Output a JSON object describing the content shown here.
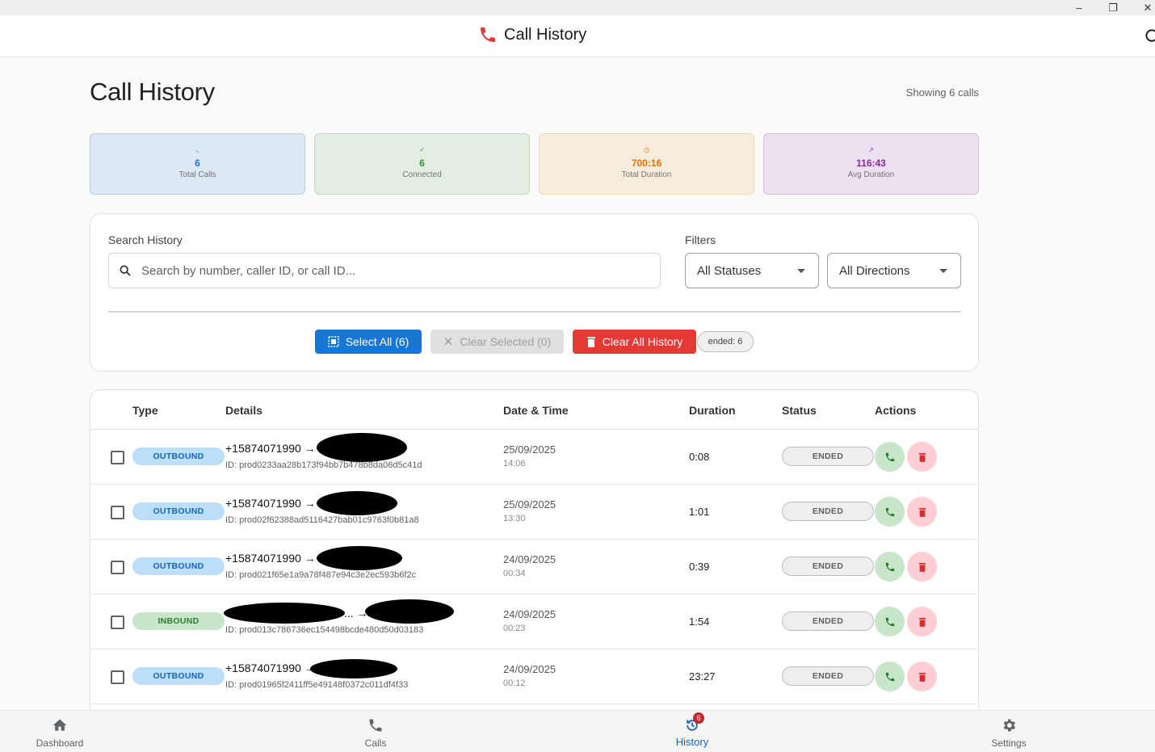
{
  "window": {
    "min": "–",
    "max": "❐",
    "close": "✕"
  },
  "header": {
    "title": "Call History"
  },
  "page": {
    "title": "Call History",
    "showing": "Showing 6 calls"
  },
  "stats": [
    {
      "value": "6",
      "label": "Total Calls",
      "color": "#1976d2",
      "icon": "phone-icon"
    },
    {
      "value": "6",
      "label": "Connected",
      "color": "#388e3c",
      "icon": "check-icon"
    },
    {
      "value": "700:16",
      "label": "Total Duration",
      "color": "#ef6c00",
      "icon": "clock-icon"
    },
    {
      "value": "116:43",
      "label": "Avg Duration",
      "color": "#8e24aa",
      "icon": "trend-icon"
    }
  ],
  "search": {
    "label": "Search History",
    "placeholder": "Search by number, caller ID, or call ID..."
  },
  "filters": {
    "label": "Filters",
    "status": "All Statuses",
    "direction": "All Directions"
  },
  "actions": {
    "select_all": "Select All (6)",
    "clear_selected": "Clear Selected (0)",
    "clear_all": "Clear All History",
    "ended_chip": "ended: 6"
  },
  "table": {
    "headers": {
      "type": "Type",
      "details": "Details",
      "datetime": "Date & Time",
      "duration": "Duration",
      "status": "Status",
      "actions": "Actions"
    },
    "rows": [
      {
        "direction": "OUTBOUND",
        "number": "+15874071990 →",
        "call_id": "ID: prod0233aa28b173f94bb7b478b8da06d5c41d",
        "date": "25/09/2025",
        "time": "14:06",
        "duration": "0:08",
        "status": "ENDED"
      },
      {
        "direction": "OUTBOUND",
        "number": "+15874071990 →",
        "call_id": "ID: prod02f62388ad5116427bab01c9763f0b81a8",
        "date": "25/09/2025",
        "time": "13:30",
        "duration": "1:01",
        "status": "ENDED"
      },
      {
        "direction": "OUTBOUND",
        "number": "+15874071990 →",
        "call_id": "ID: prod021f65e1a9a78f487e94c3e2ec593b6f2c",
        "date": "24/09/2025",
        "time": "00:34",
        "duration": "0:39",
        "status": "ENDED"
      },
      {
        "direction": "INBOUND",
        "number": "... →",
        "call_id": "ID: prod013c786736ec154498bcde480d50d03183",
        "date": "24/09/2025",
        "time": "00:23",
        "duration": "1:54",
        "status": "ENDED"
      },
      {
        "direction": "OUTBOUND",
        "number": "+15874071990 →",
        "call_id": "ID: prod01965f2411ff5e49148f0372c011df4f33",
        "date": "24/09/2025",
        "time": "00:12",
        "duration": "23:27",
        "status": "ENDED"
      }
    ]
  },
  "nav": {
    "dashboard": "Dashboard",
    "calls": "Calls",
    "history": "History",
    "settings": "Settings",
    "history_badge": "6"
  }
}
